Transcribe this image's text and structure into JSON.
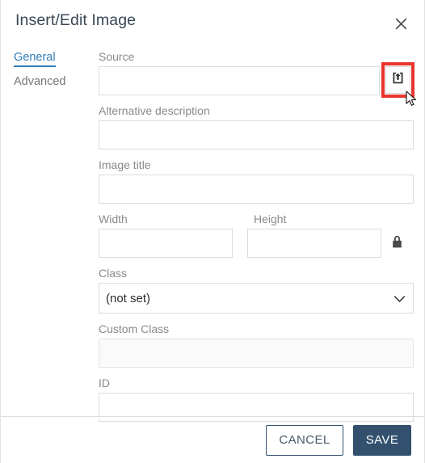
{
  "dialog": {
    "title": "Insert/Edit Image",
    "close_icon": "close-icon"
  },
  "tabs": [
    {
      "label": "General",
      "active": true
    },
    {
      "label": "Advanced",
      "active": false
    }
  ],
  "fields": {
    "source": {
      "label": "Source",
      "value": "",
      "placeholder": "",
      "browse_icon": "upload-image-icon",
      "highlighted": true
    },
    "alt": {
      "label": "Alternative description",
      "value": "",
      "placeholder": ""
    },
    "image_title": {
      "label": "Image title",
      "value": "",
      "placeholder": ""
    },
    "width": {
      "label": "Width",
      "value": "",
      "placeholder": ""
    },
    "height": {
      "label": "Height",
      "value": "",
      "placeholder": ""
    },
    "constrain": {
      "icon": "lock-closed-icon"
    },
    "css_class": {
      "label": "Class",
      "selected": "(not set)",
      "options": [
        "(not set)"
      ],
      "chevron_icon": "chevron-down-icon"
    },
    "custom_class": {
      "label": "Custom Class",
      "value": "",
      "placeholder": ""
    },
    "id": {
      "label": "ID",
      "value": "",
      "placeholder": ""
    }
  },
  "footer": {
    "cancel_label": "CANCEL",
    "save_label": "SAVE"
  },
  "colors": {
    "accent_tab": "#2f7cb8",
    "primary_button": "#33506f",
    "annotation": "#e8352e",
    "label_text": "#8a8a8a",
    "title_text": "#3a4856"
  }
}
